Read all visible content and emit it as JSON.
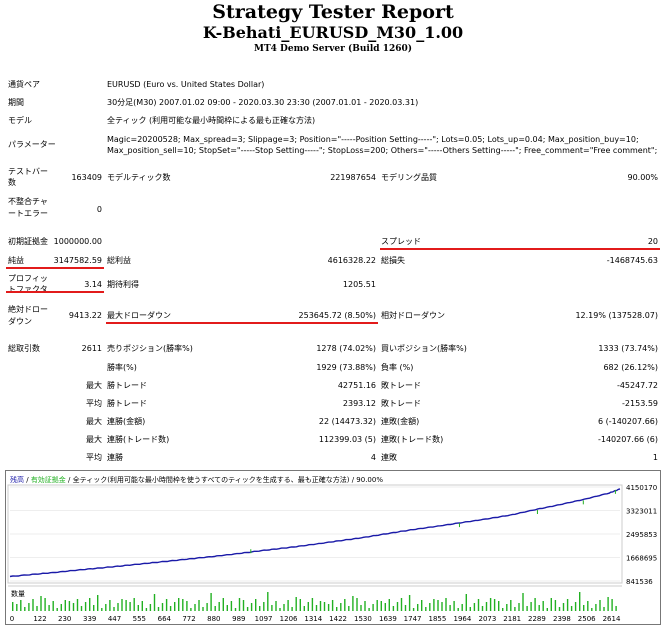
{
  "header": {
    "title": "Strategy Tester Report",
    "ea": "K-Behati_EURUSD_M30_1.00",
    "server": "MT4 Demo Server (Build 1260)"
  },
  "info": {
    "symbol_label": "通貨ペア",
    "symbol": "EURUSD (Euro vs. United States Dollar)",
    "period_label": "期間",
    "period": "30分足(M30) 2007.01.02 09:00 - 2020.03.30 23:30 (2007.01.01 - 2020.03.31)",
    "model_label": "モデル",
    "model": "全ティック (利用可能な最小時間枠による最も正確な方法)",
    "params_label": "パラメーター",
    "params_line1": "Magic=20200528; Max_spread=3; Slippage=3; Position=\"-----Position Setting-----\"; Lots=0.05; Lots_up=0.04; Max_position_buy=10;",
    "params_line2": "Max_position_sell=10; StopSet=\"-----Stop Setting-----\"; StopLoss=200; Others=\"-----Others Setting-----\"; Free_comment=\"Free comment\";"
  },
  "stats": {
    "bars_label_1": "テストバー",
    "bars_label_2": "数",
    "bars": "163409",
    "ticks_label": "モデルティック数",
    "ticks": "221987654",
    "quality_label": "モデリング品質",
    "quality": "90.00%",
    "mismatch_label_1": "不整合チャ",
    "mismatch_label_2": "ートエラー",
    "mismatch": "0",
    "deposit_label": "初期証拠金",
    "deposit": "1000000.00",
    "spread_label": "スプレッド",
    "spread": "20",
    "net_label": "純益",
    "net": "3147582.59",
    "gross_profit_label": "総利益",
    "gross_profit": "4616328.22",
    "gross_loss_label": "総損失",
    "gross_loss": "-1468745.63",
    "pf_label_1": "プロフィッ",
    "pf_label_2": "トファクタ",
    "pf": "3.14",
    "expected_label": "期待利得",
    "expected": "1205.51",
    "abs_dd_label_1": "絶対ドロー",
    "abs_dd_label_2": "ダウン",
    "abs_dd": "9413.22",
    "max_dd_label": "最大ドローダウン",
    "max_dd": "253645.72 (8.50%)",
    "rel_dd_label": "相対ドローダウン",
    "rel_dd": "12.19% (137528.07)",
    "total_trades_label": "総取引数",
    "total_trades": "2611",
    "short_label": "売りポジション(勝率%)",
    "short": "1278 (74.02%)",
    "long_label": "買いポジション(勝率%)",
    "long": "1333 (73.74%)",
    "win_label": "勝率(%)",
    "win": "1929 (73.88%)",
    "loss_label": "負率 (%)",
    "loss": "682 (26.12%)",
    "largest": "最大",
    "average": "平均",
    "largest_win_label": "勝トレード",
    "largest_win": "42751.16",
    "largest_loss_label": "敗トレード",
    "largest_loss": "-45247.72",
    "avg_win_label": "勝トレード",
    "avg_win": "2393.12",
    "avg_loss_label": "敗トレード",
    "avg_loss": "-2153.59",
    "max_cons_win_label": "連勝(金額)",
    "max_cons_win": "22 (14473.32)",
    "max_cons_loss_label": "連敗(金額)",
    "max_cons_loss": "6 (-140207.66)",
    "max_cons_profit_label": "連勝(トレード数)",
    "max_cons_profit": "112399.03 (5)",
    "max_cons_lossamt_label": "連敗(トレード数)",
    "max_cons_lossamt": "-140207.66 (6)",
    "avg_cons_win_label": "連勝",
    "avg_cons_win": "4",
    "avg_cons_loss_label": "連敗",
    "avg_cons_loss": "1"
  },
  "colors": {
    "accent_line": "#e21b1b",
    "balance": "#1a1aa8",
    "volume": "#22b022"
  },
  "chart_data": {
    "type": "line",
    "legend_balance": "残高",
    "legend_equity": "有効証拠金",
    "legend_sep": " / ",
    "legend_rest": " / 全ティック(利用可能な最小時間枠を使うすべてのティックを生成する、最も正確な方法) / 90.00%",
    "volume_label": "数量",
    "ylim": [
      841536,
      4150170
    ],
    "y_ticks": [
      "4150170",
      "3323011",
      "2495853",
      "1668695",
      "841536"
    ],
    "y_tick_values": [
      4150170,
      3323011,
      2495853,
      1668695,
      841536
    ],
    "x_ticks": [
      "0",
      "122",
      "230",
      "339",
      "447",
      "555",
      "664",
      "772",
      "880",
      "989",
      "1097",
      "1206",
      "1314",
      "1422",
      "1530",
      "1639",
      "1747",
      "1855",
      "1964",
      "2073",
      "2181",
      "2289",
      "2398",
      "2506",
      "2614"
    ],
    "x": [
      0,
      122,
      230,
      339,
      447,
      555,
      664,
      772,
      880,
      989,
      1097,
      1206,
      1314,
      1422,
      1530,
      1639,
      1747,
      1855,
      1964,
      2073,
      2181,
      2289,
      2398,
      2506,
      2614,
      2660
    ],
    "series": [
      {
        "name": "残高",
        "values": [
          1000000,
          1090000,
          1170000,
          1260000,
          1340000,
          1430000,
          1520000,
          1610000,
          1700000,
          1800000,
          1910000,
          2010000,
          2120000,
          2240000,
          2360000,
          2500000,
          2640000,
          2760000,
          2890000,
          3020000,
          3160000,
          3350000,
          3530000,
          3720000,
          3940000,
          4080000
        ]
      }
    ]
  }
}
